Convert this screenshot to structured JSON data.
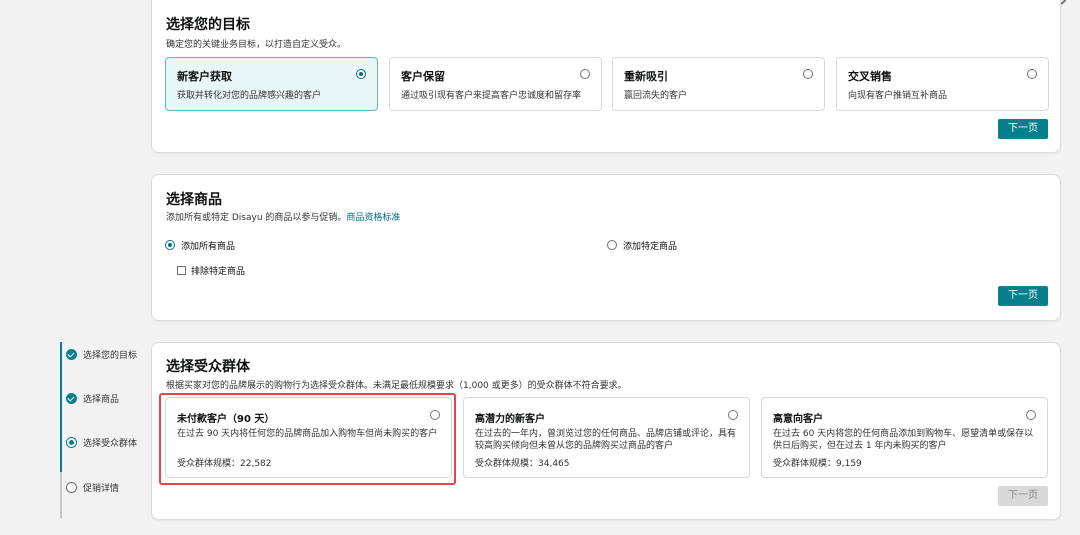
{
  "goal": {
    "title": "选择您的目标",
    "desc": "确定您的关键业务目标，以打造自定义受众。",
    "options": [
      {
        "title": "新客户获取",
        "desc": "获取并转化对您的品牌感兴趣的客户"
      },
      {
        "title": "客户保留",
        "desc": "通过吸引现有客户来提高客户忠诚度和留存率"
      },
      {
        "title": "重新吸引",
        "desc": "赢回流失的客户"
      },
      {
        "title": "交叉销售",
        "desc": "向现有客户推销互补商品"
      }
    ],
    "next": "下一页"
  },
  "products": {
    "title": "选择商品",
    "desc": "添加所有或特定 Disayu 的商品以参与促销。",
    "link": "商品资格标准",
    "all": "添加所有商品",
    "specific": "添加特定商品",
    "exclude": "排除特定商品",
    "next": "下一页"
  },
  "audience": {
    "title": "选择受众群体",
    "desc": "根据买家对您的品牌展示的购物行为选择受众群体。未满足最低规模要求（1,000 或更多）的受众群体不符合要求。",
    "options": [
      {
        "title": "未付款客户（90 天）",
        "desc": "在过去 90 天内将任何您的品牌商品加入购物车但尚未购买的客户",
        "size": "受众群体规模：22,582"
      },
      {
        "title": "高潜力的新客户",
        "desc": "在过去的一年内，曾浏览过您的任何商品、品牌店铺或评论，具有较高购买倾向但未曾从您的品牌购买过商品的客户",
        "size": "受众群体规模：34,465"
      },
      {
        "title": "高意向客户",
        "desc": "在过去 60 天内将您的任何商品添加到购物车、愿望清单或保存以供日后购买，但在过去 1 年内未购买的客户",
        "size": "受众群体规模：9,159"
      }
    ],
    "next": "下一页"
  },
  "steps": [
    {
      "label": "选择您的目标"
    },
    {
      "label": "选择商品"
    },
    {
      "label": "选择受众群体"
    },
    {
      "label": "促销详情"
    }
  ]
}
